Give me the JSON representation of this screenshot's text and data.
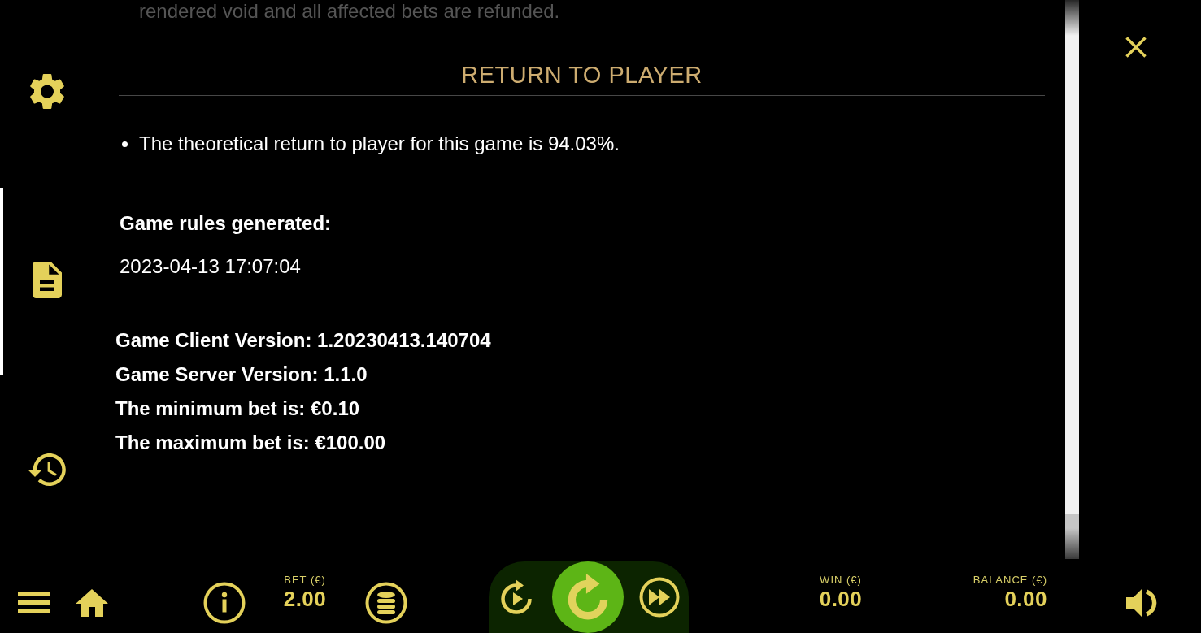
{
  "sidebar": {
    "items": [
      {
        "kind": "settings",
        "selected": false
      },
      {
        "kind": "rules",
        "selected": true
      },
      {
        "kind": "history",
        "selected": false
      }
    ]
  },
  "section": {
    "previous_text": "rendered void and all affected bets are refunded.",
    "title": "RETURN TO PLAYER",
    "bullets": [
      "The theoretical return to player for this game is 94.03%."
    ],
    "generated_label": "Game rules generated:",
    "generated_value": "2023-04-13 17:07:04",
    "info_lines": [
      "Game Client Version: 1.20230413.140704",
      "Game Server Version: 1.1.0",
      "The minimum bet is: €0.10",
      "The maximum bet is: €100.00"
    ]
  },
  "bottom_bar": {
    "bet": {
      "label": "BET (€)",
      "value": "2.00"
    },
    "win": {
      "label": "WIN (€)",
      "value": "0.00"
    },
    "balance": {
      "label": "BALANCE (€)",
      "value": "0.00"
    }
  }
}
